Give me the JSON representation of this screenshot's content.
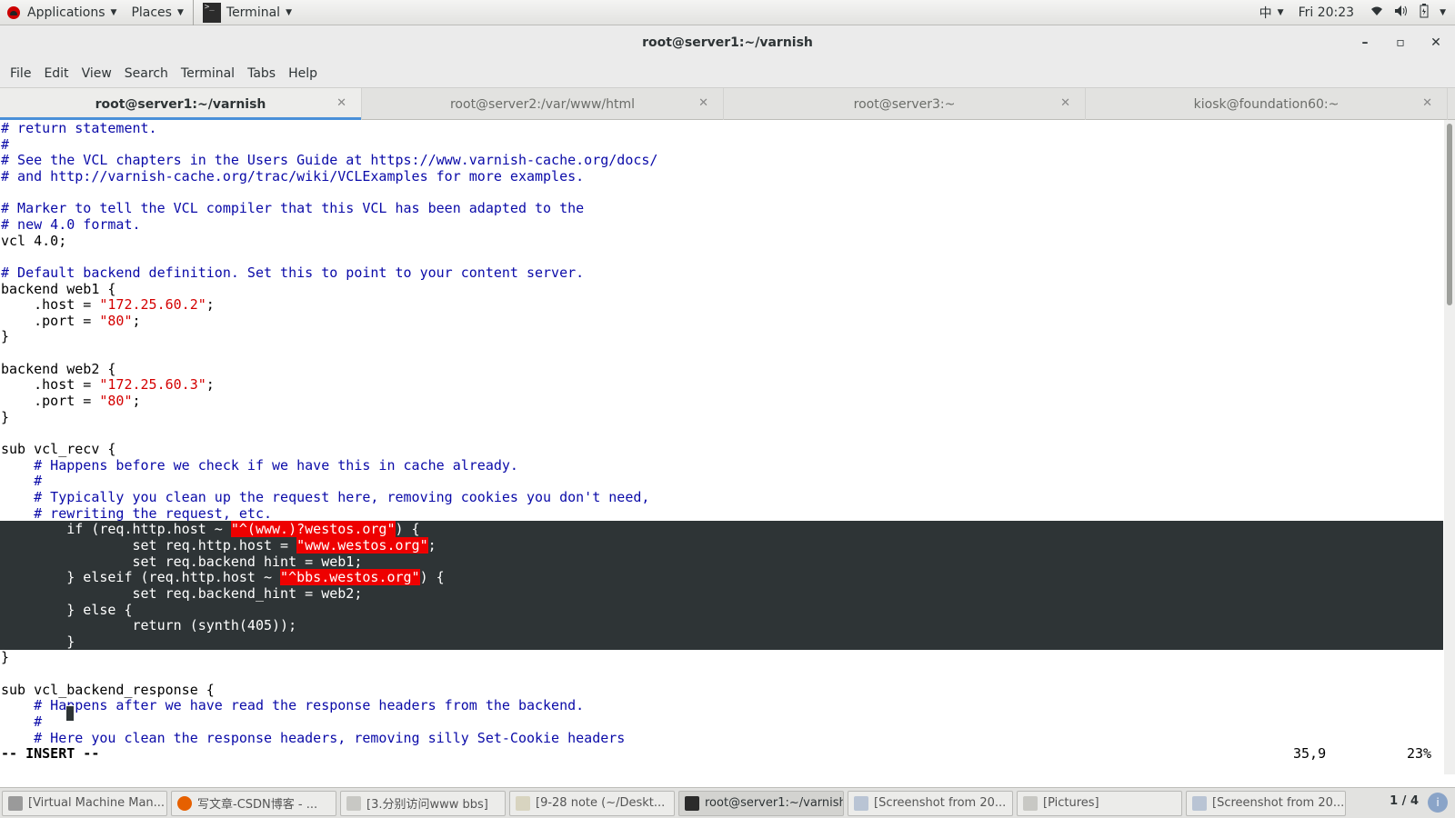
{
  "panel": {
    "applications": "Applications",
    "places": "Places",
    "terminal_app": "Terminal",
    "input_method": "中",
    "clock": "Fri 20:23",
    "icons": [
      "wifi-icon",
      "volume-icon",
      "battery-icon",
      "power-menu-icon"
    ]
  },
  "window": {
    "title": "root@server1:~/varnish",
    "minimize": "–",
    "maximize": "▫",
    "close": "✕"
  },
  "menubar": [
    "File",
    "Edit",
    "View",
    "Search",
    "Terminal",
    "Tabs",
    "Help"
  ],
  "tabs": [
    {
      "label": "root@server1:~/varnish",
      "active": true
    },
    {
      "label": "root@server2:/var/www/html",
      "active": false
    },
    {
      "label": "root@server3:~",
      "active": false
    },
    {
      "label": "kiosk@foundation60:~",
      "active": false
    }
  ],
  "editor": {
    "lines": [
      {
        "kind": "cm",
        "text": "# return statement."
      },
      {
        "kind": "cm",
        "text": "#"
      },
      {
        "kind": "cm",
        "text": "# See the VCL chapters in the Users Guide at https://www.varnish-cache.org/docs/"
      },
      {
        "kind": "cm",
        "text": "# and http://varnish-cache.org/trac/wiki/VCLExamples for more examples."
      },
      {
        "kind": "plain",
        "text": ""
      },
      {
        "kind": "cm",
        "text": "# Marker to tell the VCL compiler that this VCL has been adapted to the"
      },
      {
        "kind": "cm",
        "text": "# new 4.0 format."
      },
      {
        "kind": "plain",
        "text": "vcl 4.0;"
      },
      {
        "kind": "plain",
        "text": ""
      },
      {
        "kind": "cm",
        "text": "# Default backend definition. Set this to point to your content server."
      },
      {
        "kind": "plain",
        "text": "backend web1 {"
      },
      {
        "kind": "str",
        "pre": "    .host = ",
        "str": "\"172.25.60.2\"",
        "post": ";"
      },
      {
        "kind": "str",
        "pre": "    .port = ",
        "str": "\"80\"",
        "post": ";"
      },
      {
        "kind": "plain",
        "text": "}"
      },
      {
        "kind": "plain",
        "text": ""
      },
      {
        "kind": "plain",
        "text": "backend web2 {"
      },
      {
        "kind": "str",
        "pre": "    .host = ",
        "str": "\"172.25.60.3\"",
        "post": ";"
      },
      {
        "kind": "str",
        "pre": "    .port = ",
        "str": "\"80\"",
        "post": ";"
      },
      {
        "kind": "plain",
        "text": "}"
      },
      {
        "kind": "plain",
        "text": ""
      },
      {
        "kind": "plain",
        "text": "sub vcl_recv {"
      },
      {
        "kind": "cm",
        "text": "    # Happens before we check if we have this in cache already."
      },
      {
        "kind": "cm",
        "text": "    #"
      },
      {
        "kind": "cm",
        "text": "    # Typically you clean up the request here, removing cookies you don't need,"
      },
      {
        "kind": "cm",
        "text": "    # rewriting the request, etc."
      },
      {
        "kind": "selstr",
        "pre": "        if (req.http.host ~ ",
        "str": "\"^(www.)?westos.org\"",
        "post": ") {"
      },
      {
        "kind": "selstr",
        "pre": "                set req.http.host = ",
        "str": "\"www.westos.org\"",
        "post": ";"
      },
      {
        "kind": "sel",
        "text": "                set req.backend_hint = web1;"
      },
      {
        "kind": "selstr",
        "pre": "        } elseif (req.http.host ~ ",
        "str": "\"^bbs.westos.org\"",
        "post": ") {"
      },
      {
        "kind": "sel",
        "text": "                set req.backend_hint = web2;"
      },
      {
        "kind": "sel",
        "text": "        } else {"
      },
      {
        "kind": "sel",
        "text": "                return (synth(405));"
      },
      {
        "kind": "sel",
        "text": "        }"
      },
      {
        "kind": "plain",
        "text": "}"
      },
      {
        "kind": "plain",
        "text": ""
      },
      {
        "kind": "plain",
        "text": "sub vcl_backend_response {"
      },
      {
        "kind": "cm",
        "text": "    # Happens after we have read the response headers from the backend."
      },
      {
        "kind": "cm",
        "text": "    #"
      },
      {
        "kind": "cm",
        "text": "    # Here you clean the response headers, removing silly Set-Cookie headers"
      }
    ],
    "mode": "-- INSERT --",
    "position": "35,9",
    "percent": "23%"
  },
  "taskbar": [
    {
      "label": "[Virtual Machine Man...",
      "icon": "virt-manager-icon",
      "active": false
    },
    {
      "label": "写文章-CSDN博客 - ...",
      "icon": "firefox-icon",
      "active": false
    },
    {
      "label": "[3.分别访问www bbs]",
      "icon": "document-icon",
      "active": false
    },
    {
      "label": "[9-28 note (~/Deskt...",
      "icon": "text-editor-icon",
      "active": false
    },
    {
      "label": "root@server1:~/varnish",
      "icon": "terminal-icon",
      "active": true
    },
    {
      "label": "[Screenshot from 20...",
      "icon": "screenshot-icon",
      "active": false
    },
    {
      "label": "[Pictures]",
      "icon": "folder-icon",
      "active": false
    },
    {
      "label": "[Screenshot from 20...",
      "icon": "screenshot-icon",
      "active": false
    }
  ],
  "pager": "1 / 4",
  "colors": {
    "comment": "#0a0aa8",
    "string": "#d40000",
    "selection": "#2e3436",
    "tab_accent": "#4a90d9"
  }
}
